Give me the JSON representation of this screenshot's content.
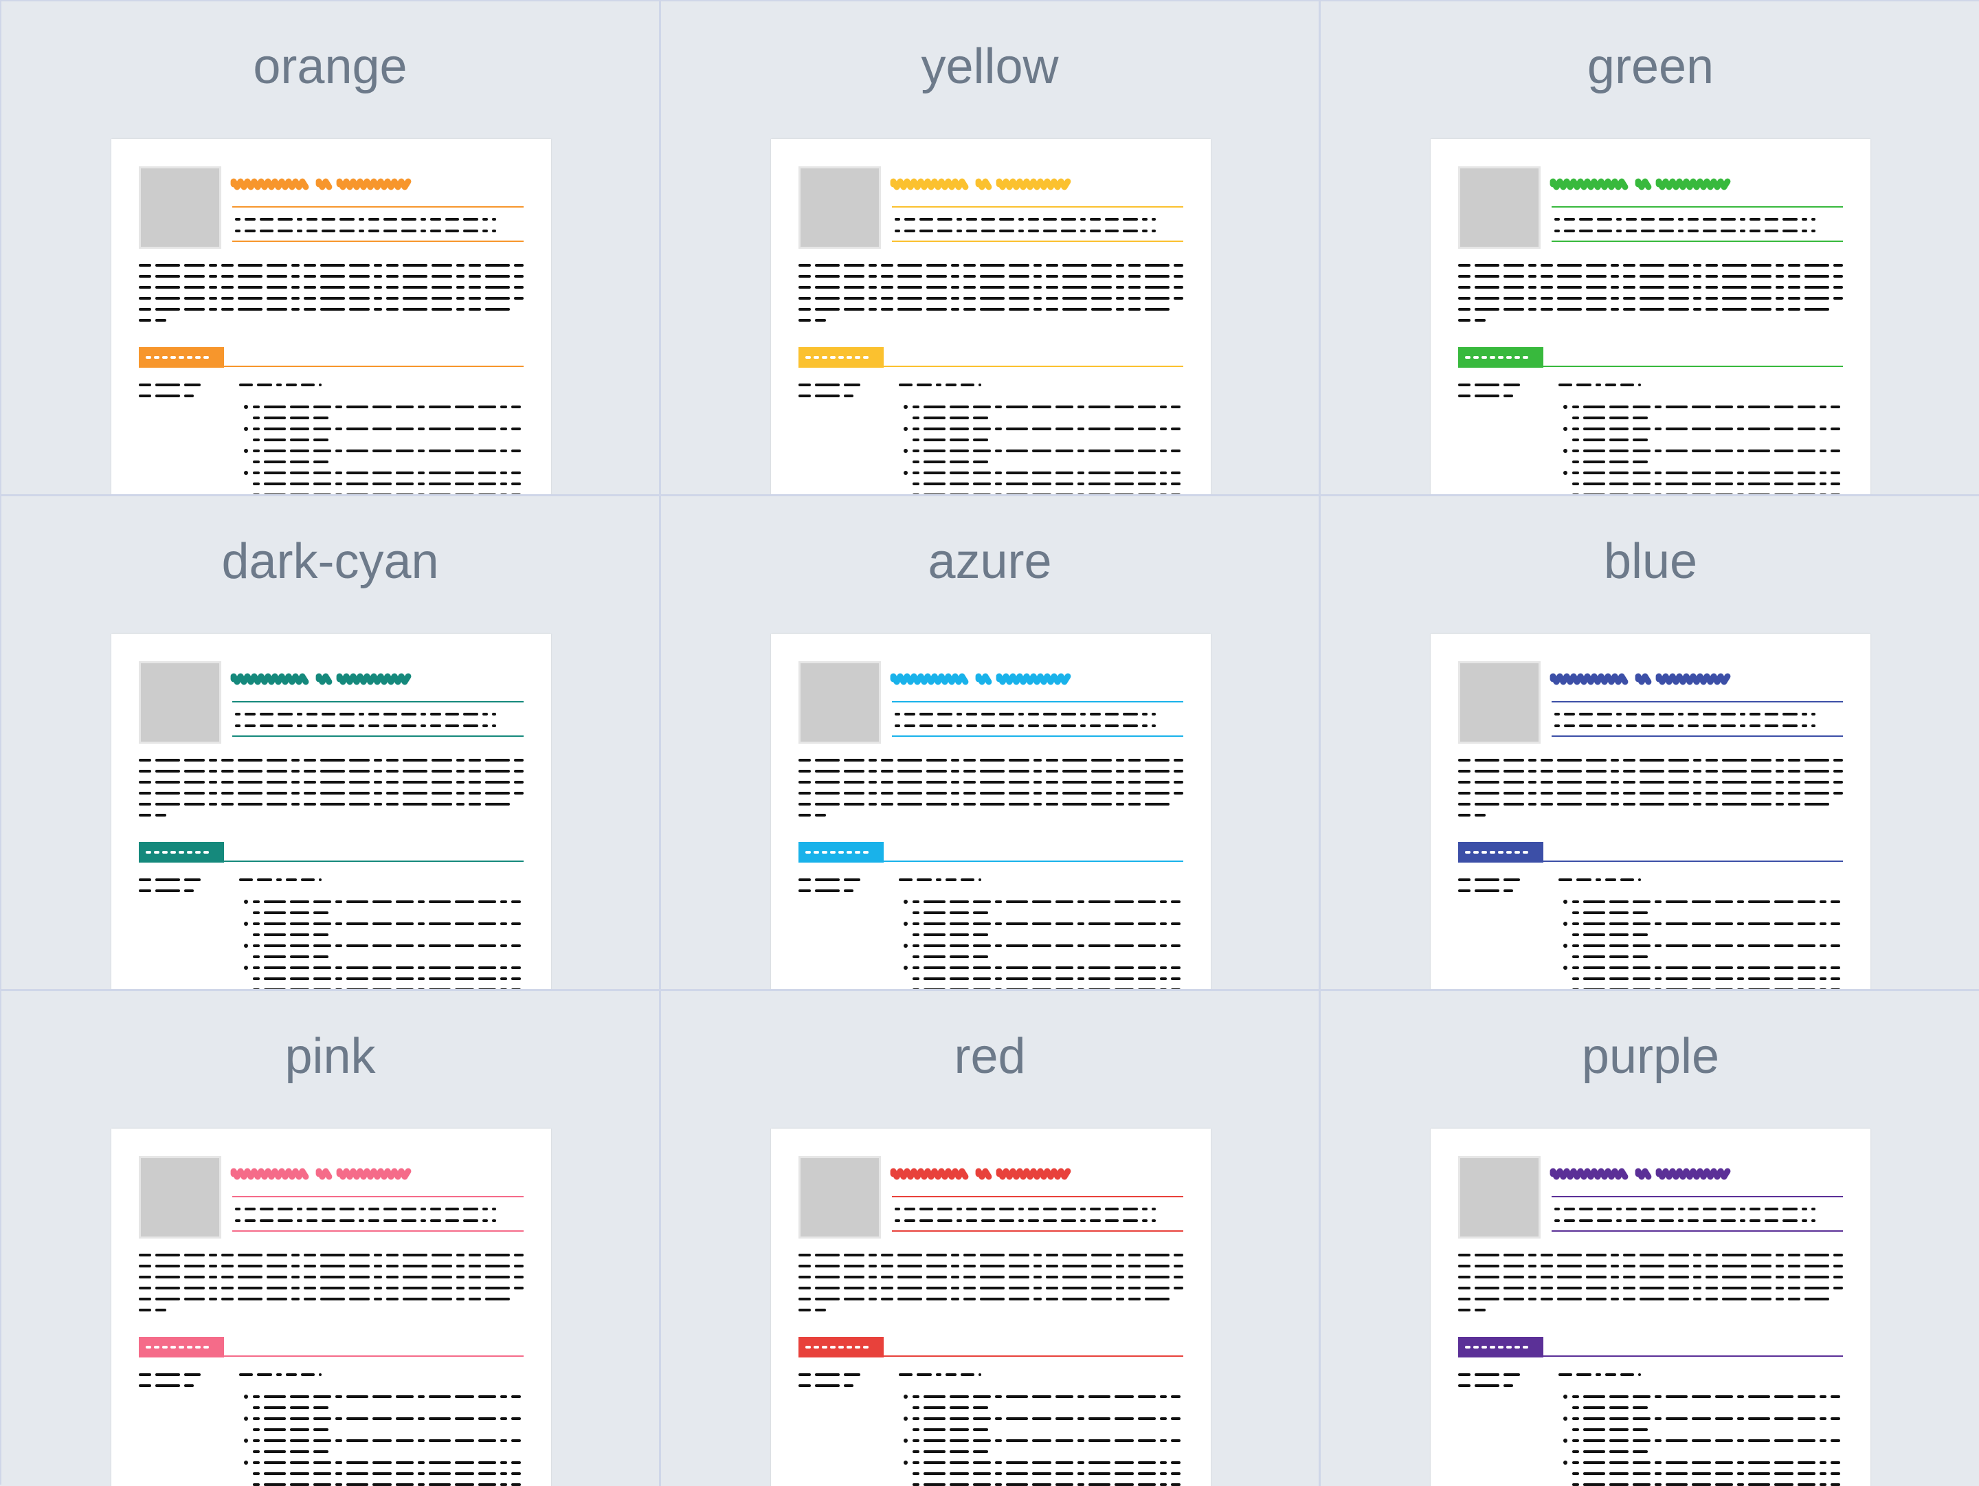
{
  "themes": [
    {
      "name": "orange",
      "color": "#f7962c"
    },
    {
      "name": "yellow",
      "color": "#fbc12f"
    },
    {
      "name": "green",
      "color": "#38b93d"
    },
    {
      "name": "dark-cyan",
      "color": "#15897c"
    },
    {
      "name": "azure",
      "color": "#19b2ea"
    },
    {
      "name": "blue",
      "color": "#3c4fa7"
    },
    {
      "name": "pink",
      "color": "#f56b89"
    },
    {
      "name": "red",
      "color": "#e8413b"
    },
    {
      "name": "purple",
      "color": "#5b3097"
    }
  ]
}
